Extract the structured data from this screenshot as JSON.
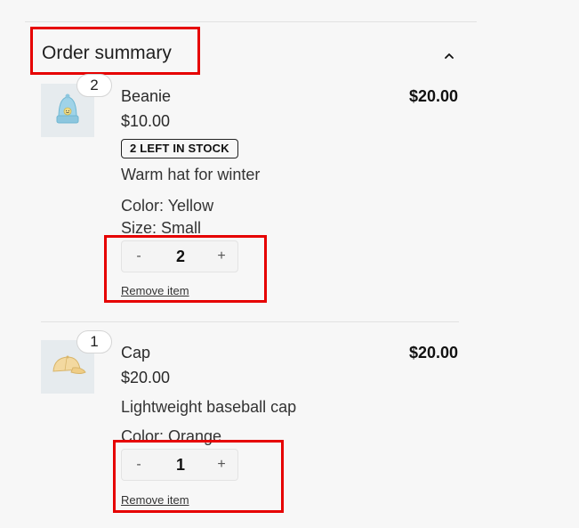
{
  "summary": {
    "title": "Order summary",
    "toggle_icon": "chevron-up-icon"
  },
  "items": [
    {
      "name": "Beanie",
      "quantity_badge": "2",
      "unit_price": "$10.00",
      "line_total": "$20.00",
      "stock_badge": "2 LEFT IN STOCK",
      "description": "Warm hat for winter",
      "attributes": [
        "Color: Yellow",
        "Size: Small"
      ],
      "stepper": {
        "decrement": "-",
        "value": "2",
        "increment": "+"
      },
      "remove_label": "Remove item",
      "thumbnail_icon": "beanie-icon"
    },
    {
      "name": "Cap",
      "quantity_badge": "1",
      "unit_price": "$20.00",
      "line_total": "$20.00",
      "description": "Lightweight baseball cap",
      "attributes": [
        "Color: Orange"
      ],
      "stepper": {
        "decrement": "-",
        "value": "1",
        "increment": "+"
      },
      "remove_label": "Remove item",
      "thumbnail_icon": "cap-icon"
    }
  ],
  "colors": {
    "highlight": "#e60000",
    "thumbnail_bg": "#e6ebee",
    "beanie": "#9fd3e8",
    "cap": "#f3d9a0"
  }
}
